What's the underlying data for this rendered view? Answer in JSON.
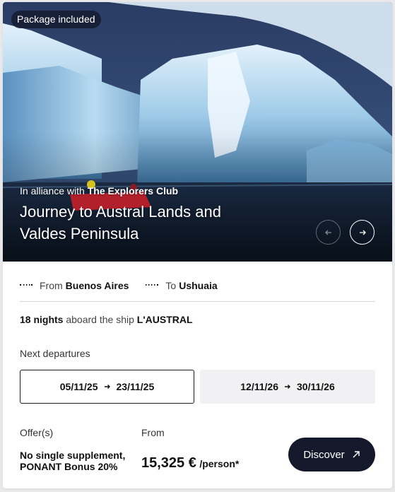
{
  "hero": {
    "badge": "Package included",
    "alliance_prefix": "In alliance with",
    "alliance_partner": "The Explorers Club",
    "title": "Journey to Austral Lands and Valdes Peninsula",
    "prev_icon": "arrow-left-icon",
    "next_icon": "arrow-right-icon"
  },
  "route": {
    "from_label": "From",
    "from_value": "Buenos Aires",
    "to_label": "To",
    "to_value": "Ushuaia"
  },
  "voyage": {
    "nights": "18 nights",
    "aboard_text": "aboard the ship",
    "ship": "L'AUSTRAL"
  },
  "departures": {
    "label": "Next departures",
    "items": [
      {
        "start": "05/11/25",
        "end": "23/11/25",
        "selected": true
      },
      {
        "start": "12/11/26",
        "end": "30/11/26",
        "selected": false
      }
    ]
  },
  "offers": {
    "label": "Offer(s)",
    "line1": "No single supplement,",
    "line2": "PONANT Bonus 20%"
  },
  "pricing": {
    "from_label": "From",
    "amount": "15,325 €",
    "unit": "/person*"
  },
  "cta": {
    "label": "Discover",
    "icon": "arrow-up-right-icon"
  },
  "colors": {
    "cta_bg": "#141a2c",
    "badge_bg": "#141c30",
    "unselected_departure_bg": "#f1f1f3"
  }
}
